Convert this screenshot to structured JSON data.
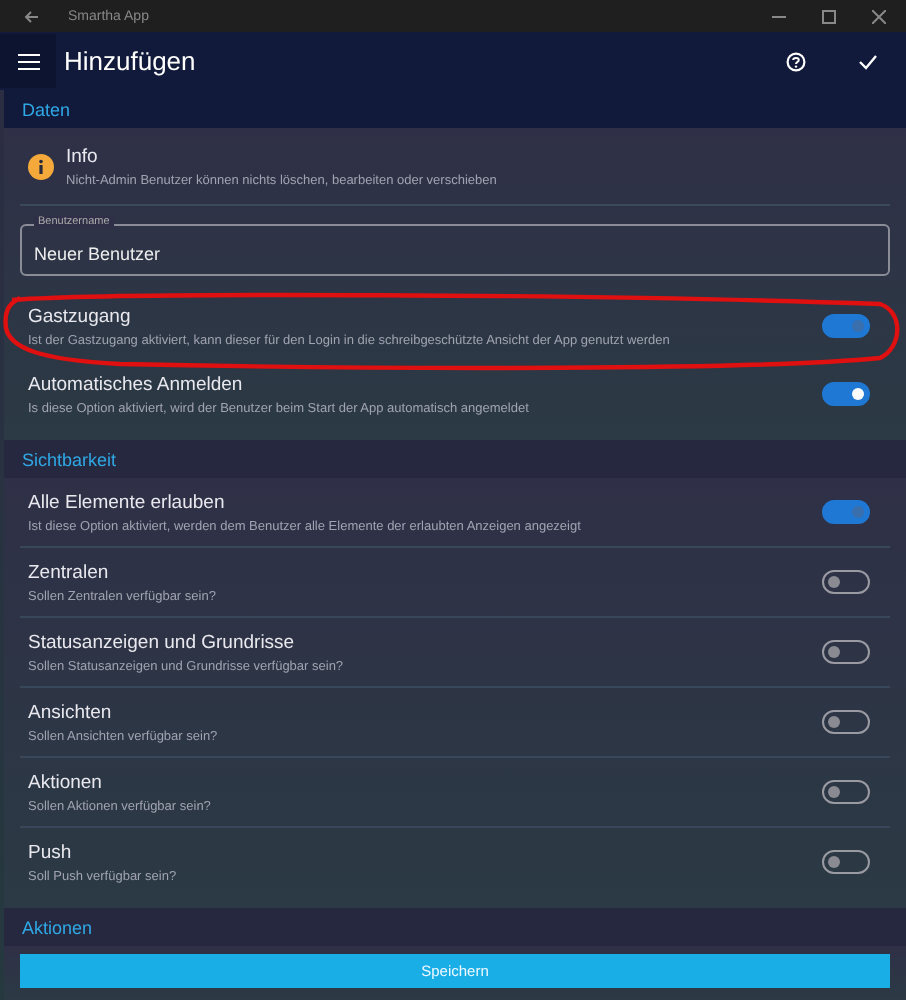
{
  "window": {
    "title": "Smartha App"
  },
  "header": {
    "title": "Hinzufügen"
  },
  "sections": [
    {
      "title": "Daten",
      "info": {
        "title": "Info",
        "text": "Nicht-Admin Benutzer können nichts löschen, bearbeiten oder verschieben"
      },
      "field": {
        "label": "Benutzername",
        "value": "Neuer Benutzer"
      },
      "toggles": [
        {
          "title": "Gastzugang",
          "subtitle": "Ist der Gastzugang aktiviert, kann dieser für den Login in die schreibgeschützte Ansicht der App genutzt werden",
          "on": true,
          "disabled": true
        },
        {
          "title": "Automatisches Anmelden",
          "subtitle": "Is diese Option aktiviert, wird der Benutzer beim Start der App automatisch angemeldet",
          "on": true,
          "disabled": false
        }
      ]
    },
    {
      "title": "Sichtbarkeit",
      "toggles": [
        {
          "title": "Alle Elemente erlauben",
          "subtitle": "Ist diese Option aktiviert, werden dem Benutzer alle Elemente der erlaubten Anzeigen angezeigt",
          "on": true,
          "disabled": true
        },
        {
          "title": "Zentralen",
          "subtitle": "Sollen Zentralen verfügbar sein?",
          "on": false,
          "disabled": false
        },
        {
          "title": "Statusanzeigen und Grundrisse",
          "subtitle": "Sollen Statusanzeigen und Grundrisse verfügbar sein?",
          "on": false,
          "disabled": false
        },
        {
          "title": "Ansichten",
          "subtitle": "Sollen Ansichten verfügbar sein?",
          "on": false,
          "disabled": false
        },
        {
          "title": "Aktionen",
          "subtitle": "Sollen Aktionen verfügbar sein?",
          "on": false,
          "disabled": false
        },
        {
          "title": "Push",
          "subtitle": "Soll Push verfügbar sein?",
          "on": false,
          "disabled": false
        }
      ]
    },
    {
      "title": "Aktionen",
      "button": "Speichern"
    }
  ]
}
